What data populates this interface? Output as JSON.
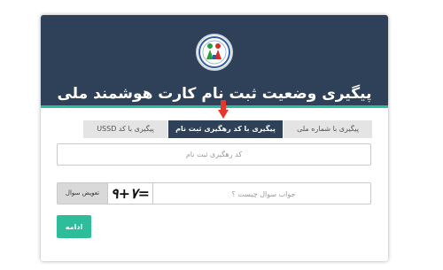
{
  "header": {
    "title": "پیگیری وضعیت ثبت نام کارت هوشمند ملی",
    "logo_icon": "national-registration-logo"
  },
  "colors": {
    "header_bg": "#2f4158",
    "accent": "#2dbd9a",
    "arrow": "#e8342a"
  },
  "tabs": [
    {
      "label": "پیگیری با کد USSD",
      "active": false
    },
    {
      "label": "پیگیری با کد رهگیری ثبت نام",
      "active": true
    },
    {
      "label": "پیگیری با شماره ملی",
      "active": false
    }
  ],
  "form": {
    "tracking_code": {
      "placeholder": "کد رهگیری ثبت نام",
      "value": ""
    },
    "captcha": {
      "change_label": "تعویض سوال",
      "question_text": "۹+۷=",
      "answer_placeholder": "جواب سوال چیست ؟",
      "answer_value": ""
    },
    "continue_label": "ادامه"
  }
}
